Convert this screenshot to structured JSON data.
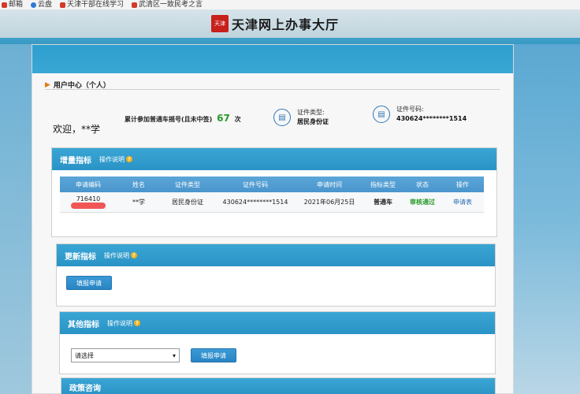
{
  "bookmarks": [
    {
      "label": "邮箱"
    },
    {
      "label": "云盘"
    },
    {
      "label": "天津干部在线学习"
    },
    {
      "label": "武清区一致民考之言"
    }
  ],
  "header": {
    "logo_seal": "天津",
    "title": "天津网上办事大厅"
  },
  "user_center": {
    "title": "用户中心（个人）",
    "welcome": "欢迎，**学",
    "stat_label": "累计参加普通车摇号(且未中签)",
    "stat_count": "67",
    "stat_unit": "次",
    "id_type_label": "证件类型:",
    "id_type_value": "居民身份证",
    "id_no_label": "证件号码:",
    "id_no_value": "430624********1514"
  },
  "increment": {
    "title": "增量指标",
    "help": "操作说明",
    "columns": [
      "申请编码",
      "姓名",
      "证件类型",
      "证件号码",
      "申请时间",
      "指标类型",
      "状态",
      "操作"
    ],
    "row": {
      "code": "716410",
      "name": "**学",
      "id_type": "居民身份证",
      "id_no": "430624********1514",
      "date": "2021年06月25日",
      "quota_type": "普通车",
      "status": "审核通过",
      "action": "申请表"
    }
  },
  "update": {
    "title": "更新指标",
    "help": "操作说明",
    "button": "填报申请"
  },
  "other": {
    "title": "其他指标",
    "help": "操作说明",
    "select_value": "请选择",
    "button": "填报申请"
  },
  "policy": {
    "title": "政策咨询"
  },
  "colors": {
    "accent": "#2e9fcf",
    "success": "#2a9a2a",
    "link": "#2a6fb4"
  }
}
